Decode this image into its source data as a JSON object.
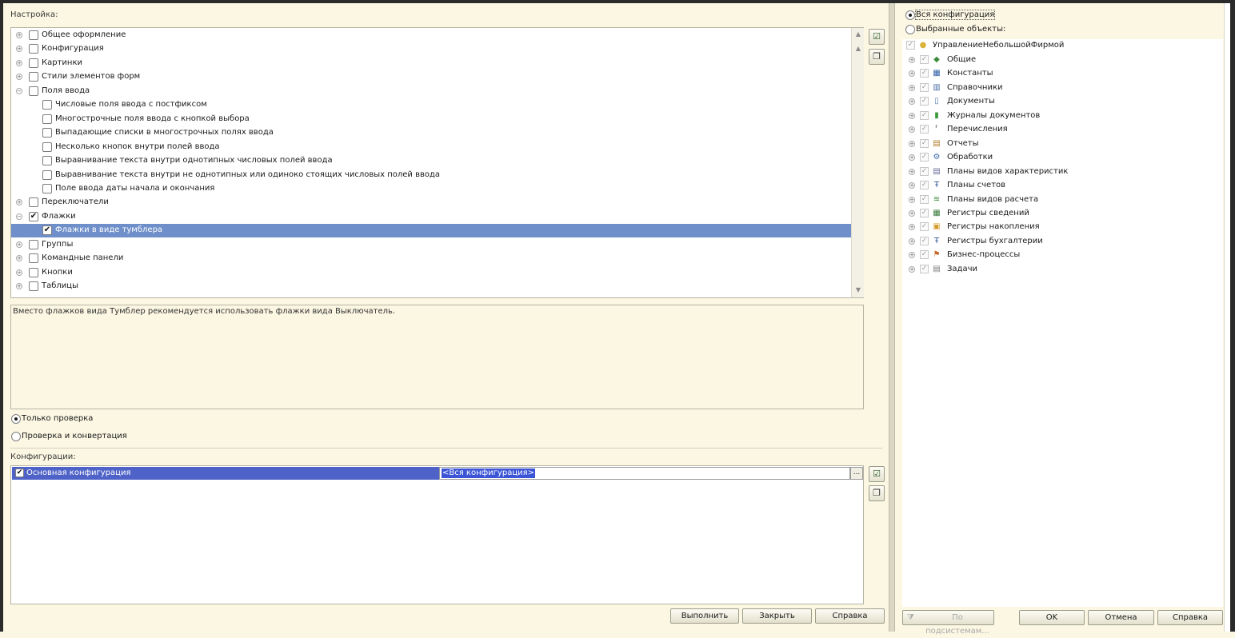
{
  "settings": {
    "label": "Настройка:",
    "tree": [
      {
        "label": "Общее оформление",
        "expander": "+",
        "checked": false,
        "level": 0
      },
      {
        "label": "Конфигурация",
        "expander": "+",
        "checked": false,
        "level": 0
      },
      {
        "label": "Картинки",
        "expander": "+",
        "checked": false,
        "level": 0
      },
      {
        "label": "Стили элементов форм",
        "expander": "+",
        "checked": false,
        "level": 0
      },
      {
        "label": "Поля ввода",
        "expander": "−",
        "checked": false,
        "level": 0
      },
      {
        "label": "Числовые поля ввода с постфиксом",
        "expander": "",
        "checked": false,
        "level": 1
      },
      {
        "label": "Многострочные поля ввода с кнопкой выбора",
        "expander": "",
        "checked": false,
        "level": 1
      },
      {
        "label": "Выпадающие списки в многострочных полях ввода",
        "expander": "",
        "checked": false,
        "level": 1
      },
      {
        "label": "Несколько кнопок внутри полей ввода",
        "expander": "",
        "checked": false,
        "level": 1
      },
      {
        "label": "Выравнивание текста внутри однотипных числовых полей ввода",
        "expander": "",
        "checked": false,
        "level": 1
      },
      {
        "label": "Выравнивание текста внутри не однотипных или одиноко стоящих числовых полей ввода",
        "expander": "",
        "checked": false,
        "level": 1
      },
      {
        "label": "Поле ввода даты начала и окончания",
        "expander": "",
        "checked": false,
        "level": 1
      },
      {
        "label": "Переключатели",
        "expander": "+",
        "checked": false,
        "level": 0
      },
      {
        "label": "Флажки",
        "expander": "−",
        "checked": true,
        "level": 0
      },
      {
        "label": "Флажки в виде тумблера",
        "expander": "",
        "checked": true,
        "level": 1,
        "selected": true
      },
      {
        "label": "Группы",
        "expander": "+",
        "checked": false,
        "level": 0
      },
      {
        "label": "Командные панели",
        "expander": "+",
        "checked": false,
        "level": 0
      },
      {
        "label": "Кнопки",
        "expander": "+",
        "checked": false,
        "level": 0
      },
      {
        "label": "Таблицы",
        "expander": "+",
        "checked": false,
        "level": 0
      }
    ],
    "description": "Вместо флажков вида Тумблер рекомендуется использовать флажки вида Выключатель."
  },
  "mode": {
    "check_only": "Только проверка",
    "check_and_convert": "Проверка и конвертация",
    "selected": "check_only"
  },
  "configurations": {
    "label": "Конфигурации:",
    "row_name": "Основная конфигурация",
    "row_value": "<Вся конфигурация>",
    "row_checked": true,
    "dots": "..."
  },
  "buttons": {
    "run": "Выполнить",
    "close": "Закрыть",
    "help": "Справка"
  },
  "scope": {
    "whole": "Вся конфигурация",
    "selected_objects": "Выбранные объекты:",
    "selected": "whole"
  },
  "objects": {
    "root": {
      "label": "УправлениеНебольшойФирмой",
      "icon": "config-icon"
    },
    "items": [
      {
        "label": "Общие",
        "icon": "common-icon"
      },
      {
        "label": "Константы",
        "icon": "constants-icon"
      },
      {
        "label": "Справочники",
        "icon": "catalogs-icon"
      },
      {
        "label": "Документы",
        "icon": "documents-icon"
      },
      {
        "label": "Журналы документов",
        "icon": "journals-icon"
      },
      {
        "label": "Перечисления",
        "icon": "enums-icon"
      },
      {
        "label": "Отчеты",
        "icon": "reports-icon"
      },
      {
        "label": "Обработки",
        "icon": "processors-icon"
      },
      {
        "label": "Планы видов характеристик",
        "icon": "char-types-icon"
      },
      {
        "label": "Планы счетов",
        "icon": "charts-of-accounts-icon"
      },
      {
        "label": "Планы видов расчета",
        "icon": "calc-types-icon"
      },
      {
        "label": "Регистры сведений",
        "icon": "info-registers-icon"
      },
      {
        "label": "Регистры накопления",
        "icon": "accum-registers-icon"
      },
      {
        "label": "Регистры бухгалтерии",
        "icon": "accounting-registers-icon"
      },
      {
        "label": "Бизнес-процессы",
        "icon": "business-processes-icon"
      },
      {
        "label": "Задачи",
        "icon": "tasks-icon"
      }
    ]
  },
  "right_buttons": {
    "by_subsystems": "По подсистемам...",
    "ok": "OK",
    "cancel": "Отмена",
    "help": "Справка"
  }
}
